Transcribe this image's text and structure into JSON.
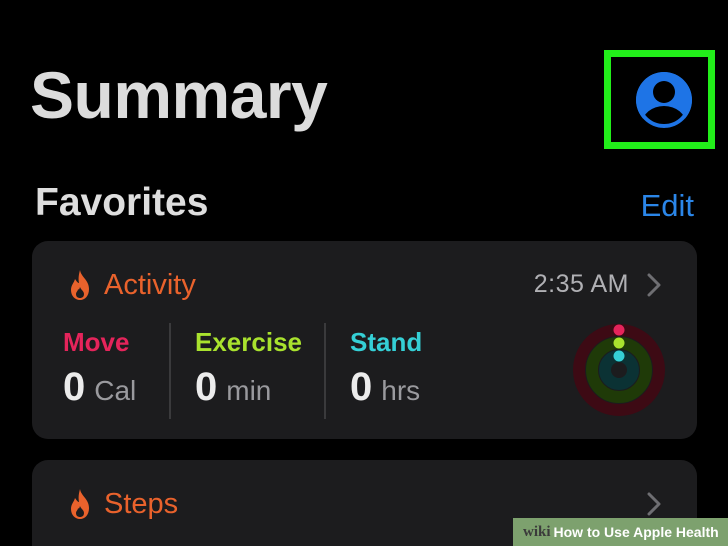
{
  "header": {
    "title": "Summary"
  },
  "favorites": {
    "title": "Favorites",
    "edit_label": "Edit"
  },
  "activity_card": {
    "title": "Activity",
    "time": "2:35 AM",
    "metrics": [
      {
        "label": "Move",
        "value": "0",
        "unit": "Cal",
        "color": "#e5245b"
      },
      {
        "label": "Exercise",
        "value": "0",
        "unit": "min",
        "color": "#a9e22e"
      },
      {
        "label": "Stand",
        "value": "0",
        "unit": "hrs",
        "color": "#35d0d6"
      }
    ]
  },
  "steps_card": {
    "title": "Steps"
  },
  "watermark": {
    "brand": "wiki",
    "text": "How to Use Apple Health"
  },
  "colors": {
    "accent_blue": "#2b86e8",
    "highlight_green": "#22ee1a",
    "activity_orange": "#e9622c"
  }
}
